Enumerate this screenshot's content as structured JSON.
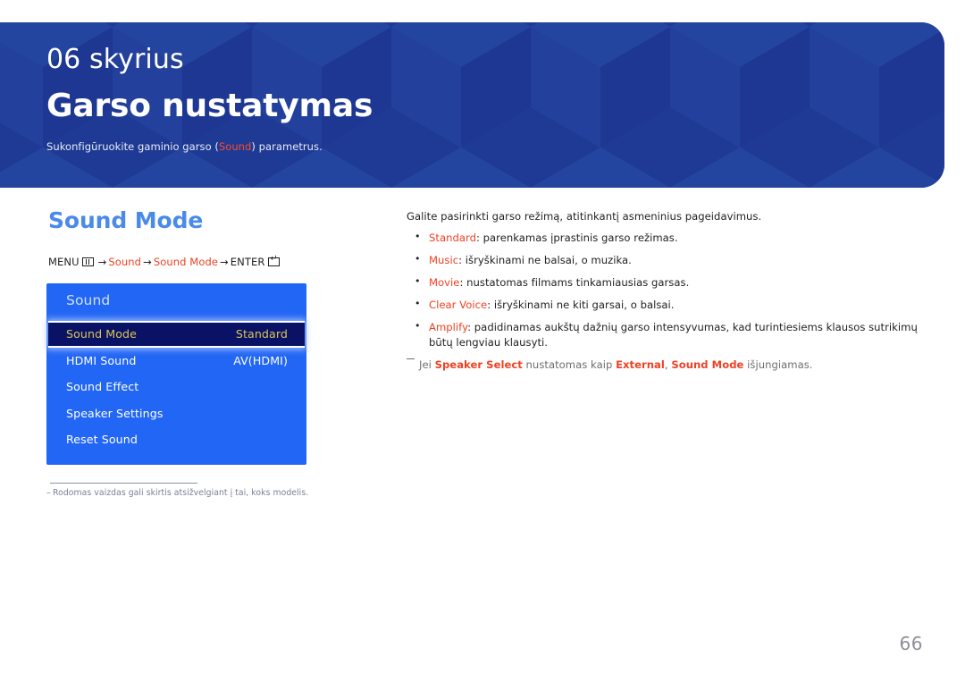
{
  "header": {
    "chapter_number": "06 skyrius",
    "chapter_title": "Garso nustatymas",
    "subtitle_before": "Sukonfigūruokite gaminio garso (",
    "subtitle_highlight": "Sound",
    "subtitle_after": ") parametrus.",
    "banner_color": "#1e3a94",
    "highlight_color": "#ff4a26"
  },
  "section": {
    "heading": "Sound Mode",
    "heading_color": "#4a8ae8"
  },
  "breadcrumb": {
    "menu_label": "MENU",
    "menu_icon": "menu-bars-icon",
    "arrow": "→",
    "crumb1": "Sound",
    "crumb2": "Sound Mode",
    "enter_label": "ENTER",
    "enter_icon": "enter-return-icon",
    "accent_color": "#ef4123"
  },
  "osd": {
    "title": "Sound",
    "background_color": "#2266f5",
    "selected_row_bg": "#0a1266",
    "selected_text_color": "#d8c755",
    "rows": [
      {
        "label": "Sound Mode",
        "value": "Standard",
        "selected": true
      },
      {
        "label": "HDMI Sound",
        "value": "AV(HDMI)",
        "selected": false
      },
      {
        "label": "Sound Effect",
        "value": "",
        "selected": false
      },
      {
        "label": "Speaker Settings",
        "value": "",
        "selected": false
      },
      {
        "label": "Reset Sound",
        "value": "",
        "selected": false
      }
    ]
  },
  "left_footnote": {
    "dash": "–",
    "text": "Rodomas vaizdas gali skirtis atsižvelgiant į tai, koks modelis."
  },
  "right": {
    "intro": "Galite pasirinkti garso režimą, atitinkantį asmeninius pageidavimus.",
    "bullets": [
      {
        "term": "Standard",
        "rest": ": parenkamas įprastinis garso režimas."
      },
      {
        "term": "Music",
        "rest": ": išryškinami ne balsai, o muzika."
      },
      {
        "term": "Movie",
        "rest": ": nustatomas filmams tinkamiausias garsas."
      },
      {
        "term": "Clear Voice",
        "rest": ": išryškinami ne kiti garsai, o balsai."
      },
      {
        "term": "Amplify",
        "rest": ": padidinamas aukštų dažnių garso intensyvumas, kad turintiesiems klausos sutrikimų būtų lengviau klausyti."
      }
    ],
    "note": {
      "p1": "Jei ",
      "s1": "Speaker Select",
      "p2": " nustatomas kaip ",
      "s2": "External",
      "p3": ", ",
      "s3": "Sound Mode",
      "p4": " išjungiamas."
    }
  },
  "footer": {
    "page_number": "66"
  }
}
